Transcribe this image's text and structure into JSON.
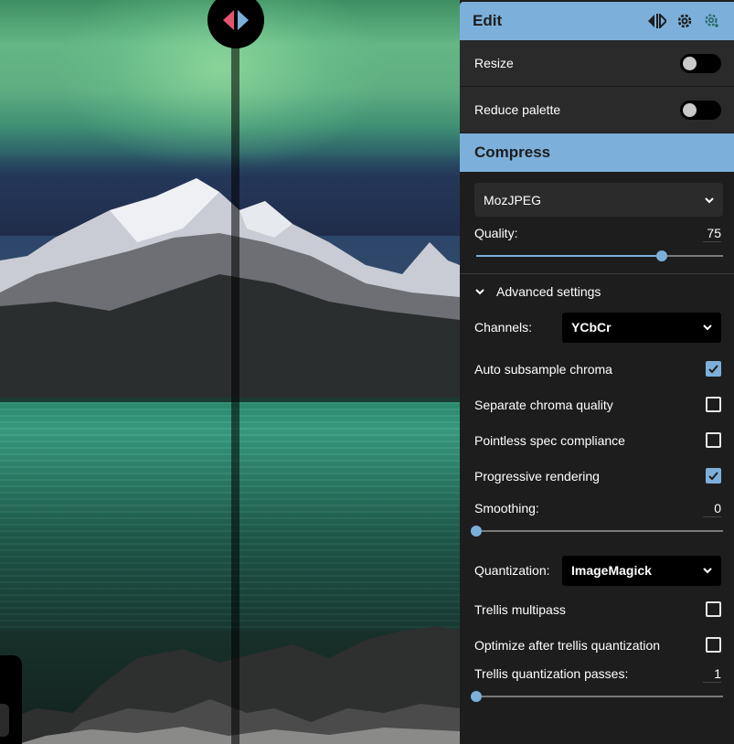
{
  "canvas": {
    "divider_handle": "split-view-handle"
  },
  "panel": {
    "header_title": "Edit",
    "header_icons": [
      "split-arrows-icon",
      "gear-icon",
      "gear-copy-icon"
    ],
    "toggles": [
      {
        "label": "Resize",
        "on": false
      },
      {
        "label": "Reduce palette",
        "on": false
      }
    ],
    "compress_title": "Compress",
    "encoder": "MozJPEG",
    "quality": {
      "label": "Quality:",
      "value": "75",
      "fraction": 0.75
    },
    "advanced_label": "Advanced settings",
    "channels": {
      "label": "Channels:",
      "value": "YCbCr"
    },
    "checks_a": [
      {
        "label": "Auto subsample chroma",
        "checked": true
      },
      {
        "label": "Separate chroma quality",
        "checked": false
      },
      {
        "label": "Pointless spec compliance",
        "checked": false
      },
      {
        "label": "Progressive rendering",
        "checked": true
      }
    ],
    "smoothing": {
      "label": "Smoothing:",
      "value": "0",
      "fraction": 0
    },
    "quantization": {
      "label": "Quantization:",
      "value": "ImageMagick"
    },
    "checks_b": [
      {
        "label": "Trellis multipass",
        "checked": false
      },
      {
        "label": "Optimize after trellis quantization",
        "checked": false
      }
    ],
    "trellis_passes": {
      "label": "Trellis quantization passes:",
      "value": "1",
      "fraction": 0
    }
  },
  "colors": {
    "accent": "#7cb0db",
    "panel_bg": "#1d1d1d",
    "handle_left": "#e2536d",
    "handle_right": "#7cb0db"
  }
}
